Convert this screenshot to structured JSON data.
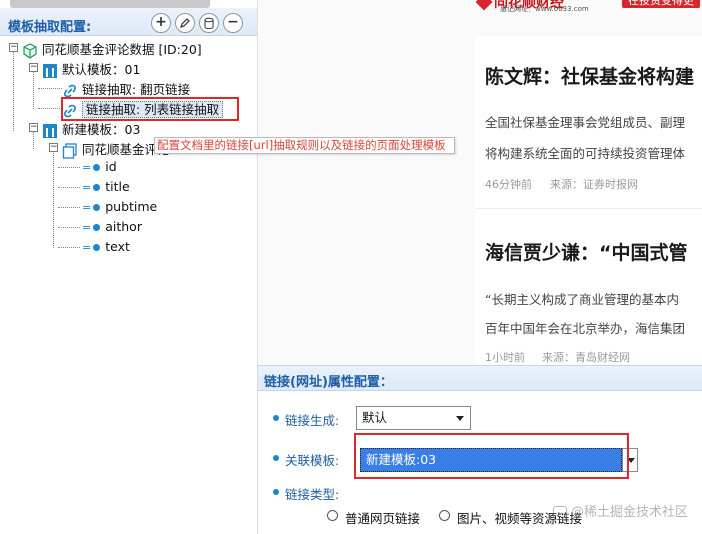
{
  "extract_panel": {
    "title": "模板抽取配置:",
    "buttons": {
      "add": "+",
      "minus": "−"
    }
  },
  "tree": {
    "root": "同花顺基金评论数据 [ID:20]",
    "default_template": "默认模板：01",
    "link_paging": "链接抽取: 翻页链接",
    "link_list": "链接抽取: 列表链接抽取",
    "new_template": "新建模板：03",
    "collection": "同花顺基金评论",
    "fields": [
      "id",
      "title",
      "pubtime",
      "aithor",
      "text"
    ],
    "field_prefix": "=●"
  },
  "tooltip": {
    "text": "配置文档里的链接[url]抽取规则以及链接的页面处理模板"
  },
  "news": {
    "logo_text": "同花顺财经",
    "logo_sub": "惠记网址：www.0033.com",
    "badge": "在投资变得更",
    "items": [
      {
        "headline": "陈文辉：社保基金将构建",
        "lines": [
          "全国社保基金理事会党组成员、副理",
          "将构建系统全面的可持续投资管理体"
        ],
        "time": "46分钟前",
        "source": "来源：证券时报网"
      },
      {
        "headline": "海信贾少谦：“中国式管",
        "lines": [
          "“长期主义构成了商业管理的基本内",
          "百年中国年会在北京举办，海信集团"
        ],
        "time": "1小时前",
        "source": "来源：青岛财经网"
      }
    ]
  },
  "link_config": {
    "title": "链接(网址)属性配置：",
    "generation_label": "链接生成:",
    "generation_value": "默认",
    "template_label": "关联模板:",
    "template_value": "新建模板:03",
    "type_label": "链接类型:",
    "type_options": [
      "普通网页链接",
      "图片、视频等资源链接"
    ]
  },
  "watermark": {
    "text": "@稀土掘金技术社区"
  },
  "colors": {
    "accent": "#1f5fa7",
    "highlight_box": "#e2272b",
    "selection": "#3a7ee8"
  }
}
